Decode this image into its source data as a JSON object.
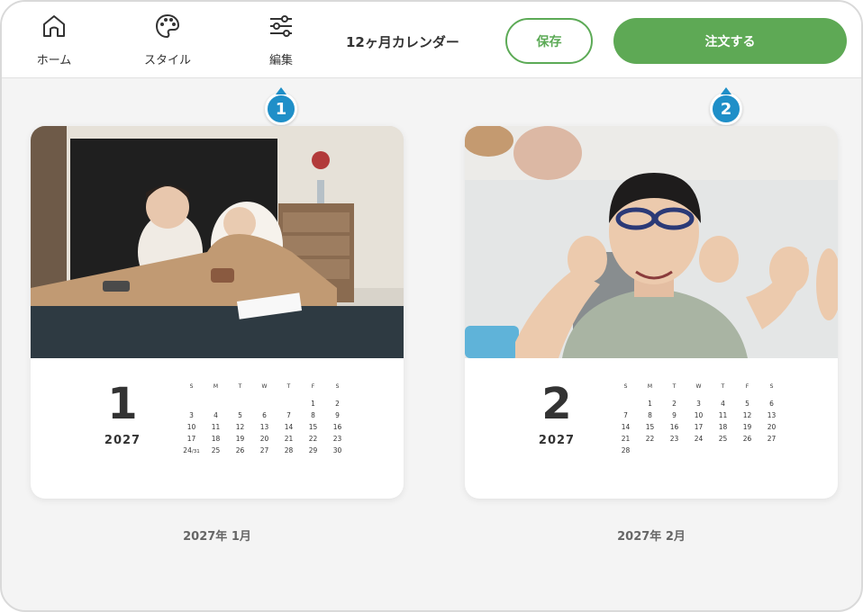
{
  "nav": [
    {
      "label": "ホーム",
      "icon": "home-icon"
    },
    {
      "label": "スタイル",
      "icon": "palette-icon"
    },
    {
      "label": "編集",
      "icon": "sliders-icon"
    }
  ],
  "header": {
    "title": "12ヶ月カレンダー",
    "save_label": "保存",
    "order_label": "注文する"
  },
  "badges": [
    "1",
    "2"
  ],
  "colors": {
    "accent": "#5ea955",
    "badge": "#1f8fc8",
    "background": "#f4f4f4"
  },
  "pages": [
    {
      "month": "1",
      "year": "2027",
      "caption": "2027年 1月",
      "weekdays": [
        "S",
        "M",
        "T",
        "W",
        "T",
        "F",
        "S"
      ],
      "weeks": [
        [
          "",
          "",
          "",
          "",
          "",
          "1",
          "2"
        ],
        [
          "3",
          "4",
          "5",
          "6",
          "7",
          "8",
          "9"
        ],
        [
          "10",
          "11",
          "12",
          "13",
          "14",
          "15",
          "16"
        ],
        [
          "17",
          "18",
          "19",
          "20",
          "21",
          "22",
          "23"
        ],
        [
          "24/31",
          "25",
          "26",
          "27",
          "28",
          "29",
          "30"
        ]
      ]
    },
    {
      "month": "2",
      "year": "2027",
      "caption": "2027年 2月",
      "weekdays": [
        "S",
        "M",
        "T",
        "W",
        "T",
        "F",
        "S"
      ],
      "weeks": [
        [
          "",
          "1",
          "2",
          "3",
          "4",
          "5",
          "6"
        ],
        [
          "7",
          "8",
          "9",
          "10",
          "11",
          "12",
          "13"
        ],
        [
          "14",
          "15",
          "16",
          "17",
          "18",
          "19",
          "20"
        ],
        [
          "21",
          "22",
          "23",
          "24",
          "25",
          "26",
          "27"
        ],
        [
          "28",
          "",
          "",
          "",
          "",
          "",
          ""
        ]
      ]
    }
  ]
}
